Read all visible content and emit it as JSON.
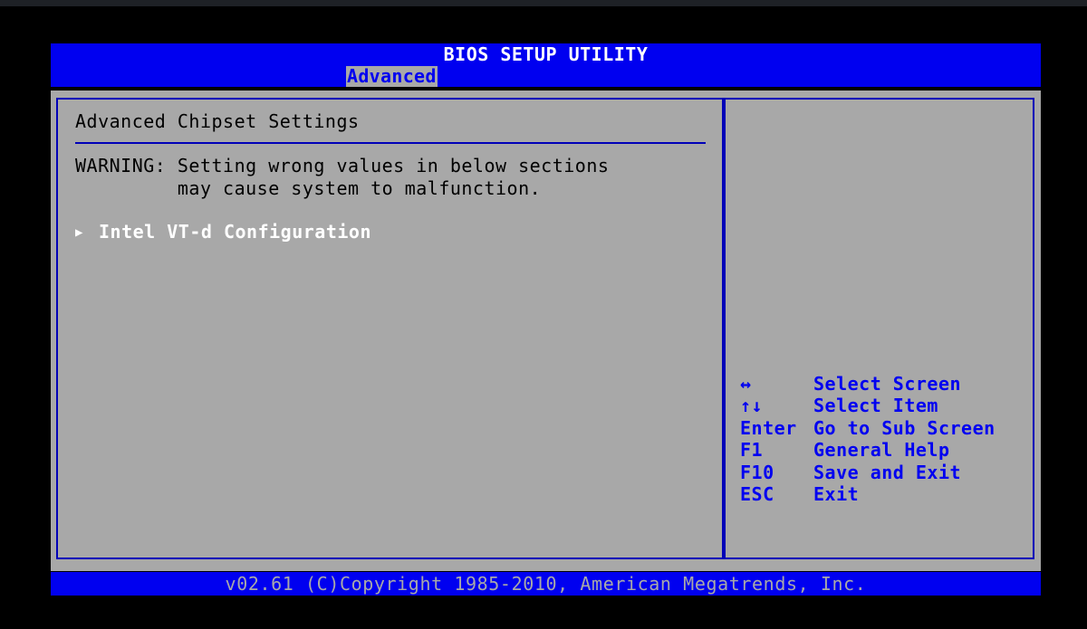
{
  "window": {
    "title": "BIOS SETUP UTILITY"
  },
  "tabs": [
    {
      "label": "Advanced",
      "active": true
    }
  ],
  "left_panel": {
    "title": "Advanced Chipset Settings",
    "warning_line1": "WARNING: Setting wrong values in below sections",
    "warning_line2": "         may cause system to malfunction.",
    "items": [
      {
        "marker": "▶",
        "label": "Intel VT-d Configuration"
      }
    ]
  },
  "help": [
    {
      "key": "↔",
      "action": "Select Screen"
    },
    {
      "key": "↑↓",
      "action": "Select Item"
    },
    {
      "key": "Enter",
      "action": "Go to Sub Screen"
    },
    {
      "key": "F1",
      "action": "General Help"
    },
    {
      "key": "F10",
      "action": "Save and Exit"
    },
    {
      "key": "ESC",
      "action": "Exit"
    }
  ],
  "footer": {
    "text": "v02.61 (C)Copyright 1985-2010, American Megatrends, Inc."
  },
  "colors": {
    "bios_blue": "#0000f0",
    "panel_gray": "#a8a8a8",
    "border_blue": "#0000b8",
    "highlight_text": "#ffffff",
    "background": "#000000"
  },
  "icons": {
    "submenu_marker": "submenu-arrow-icon"
  }
}
